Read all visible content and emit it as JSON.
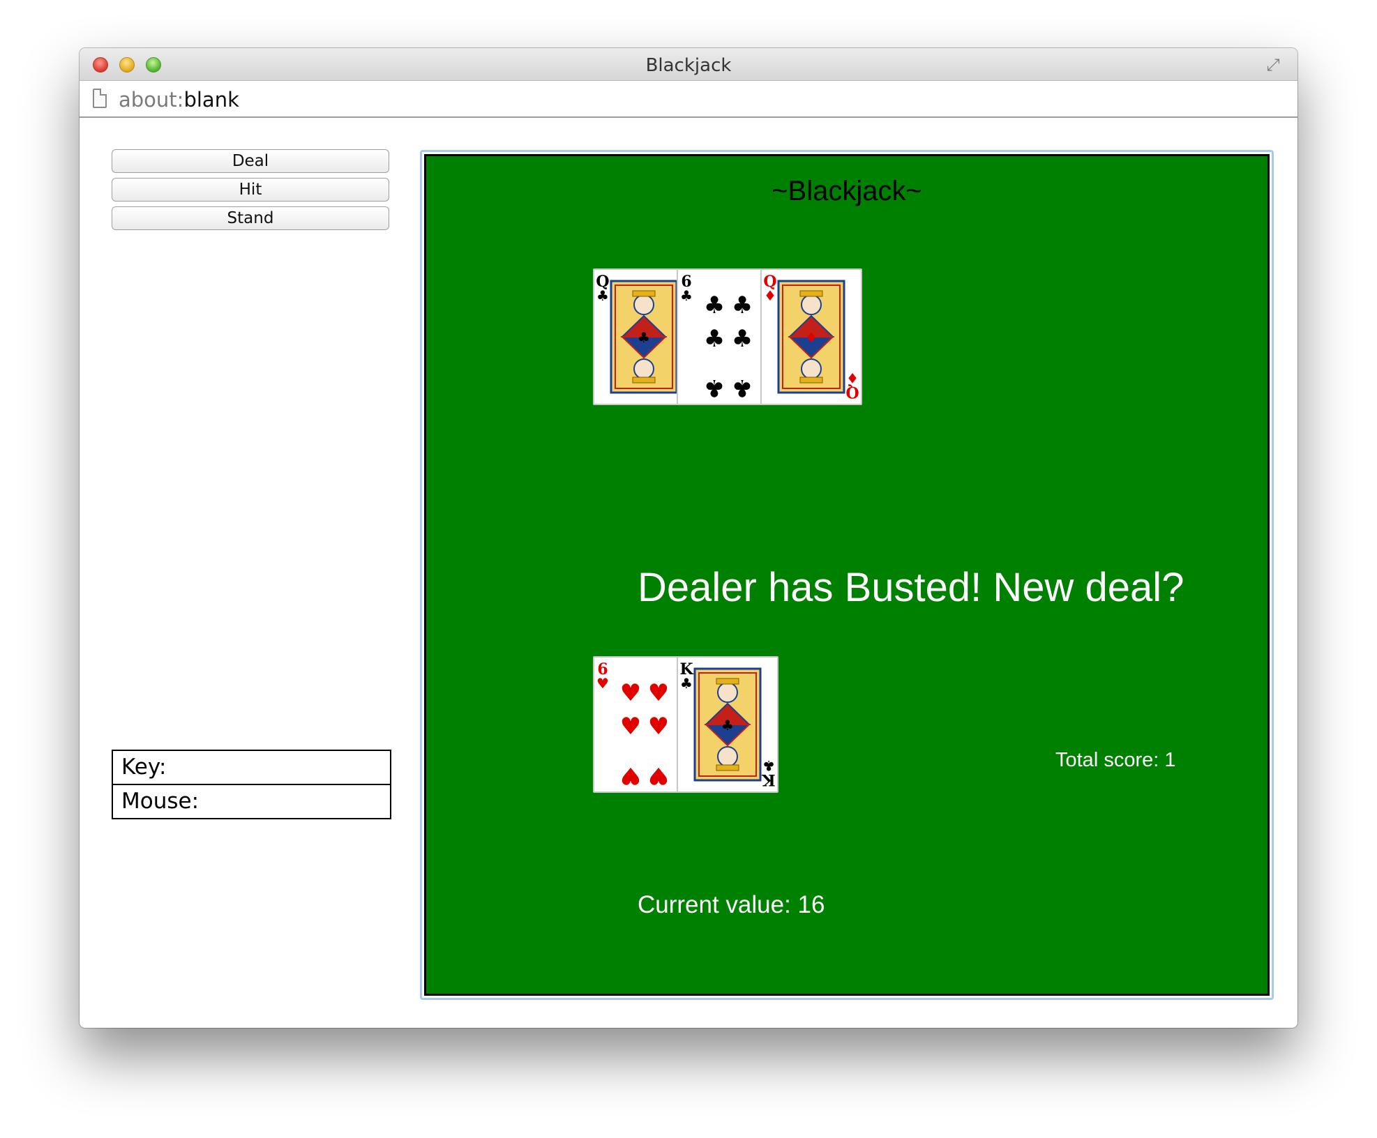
{
  "window": {
    "title": "Blackjack"
  },
  "address_bar": {
    "scheme": "about:",
    "page": "blank"
  },
  "controls": {
    "deal_label": "Deal",
    "hit_label": "Hit",
    "stand_label": "Stand",
    "key_label": "Key:",
    "mouse_label": "Mouse:"
  },
  "game": {
    "title": "~Blackjack~",
    "message": "Dealer has Busted! New deal?",
    "total_score": "Total score: 1",
    "current_value": "Current value: 16",
    "table_color": "#008000",
    "dealer_cards": [
      {
        "rank": "Q",
        "suit": "♣",
        "color": "#000000"
      },
      {
        "rank": "6",
        "suit": "♣",
        "color": "#000000"
      },
      {
        "rank": "Q",
        "suit": "♦",
        "color": "#e00000"
      }
    ],
    "player_cards": [
      {
        "rank": "6",
        "suit": "♥",
        "color": "#e00000"
      },
      {
        "rank": "K",
        "suit": "♣",
        "color": "#000000"
      }
    ]
  }
}
